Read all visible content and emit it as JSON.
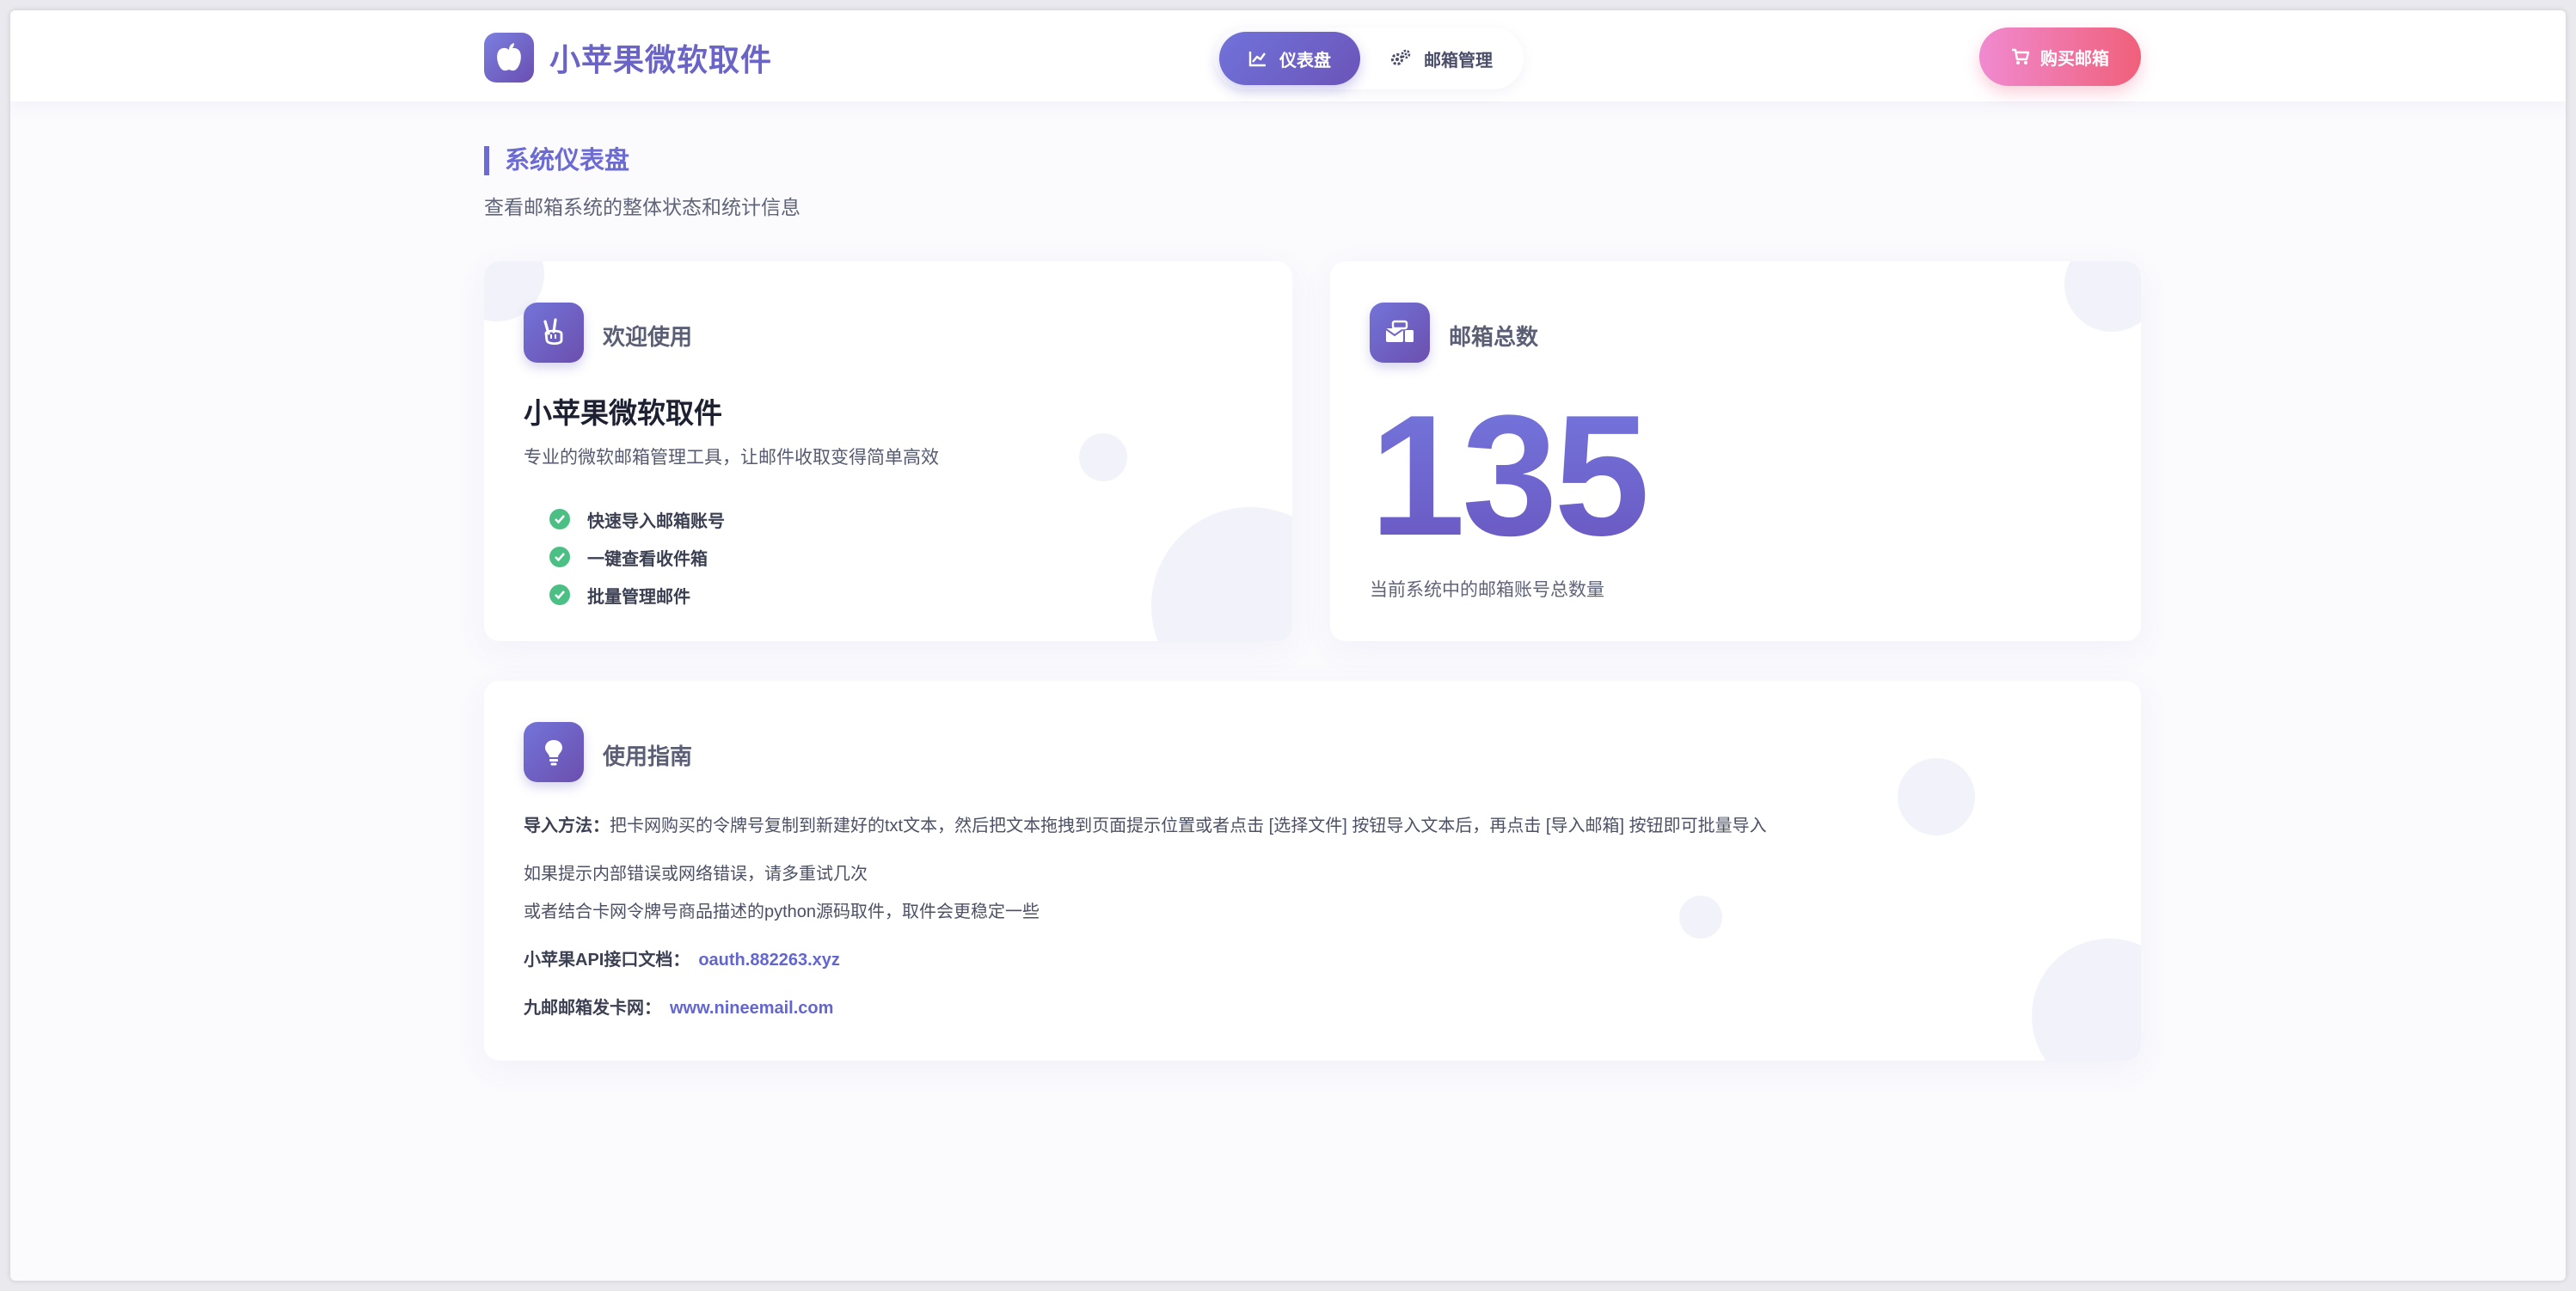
{
  "app": {
    "title": "小苹果微软取件",
    "logo_icon": "apple-icon"
  },
  "nav": {
    "tabs": [
      {
        "label": "仪表盘",
        "icon": "chart-line-icon",
        "active": true
      },
      {
        "label": "邮箱管理",
        "icon": "cogs-icon",
        "active": false
      }
    ],
    "buy_label": "购买邮箱",
    "buy_icon": "cart-icon"
  },
  "page": {
    "title": "系统仪表盘",
    "subtitle": "查看邮箱系统的整体状态和统计信息"
  },
  "welcome_card": {
    "heading": "欢迎使用",
    "icon": "hand-peace-icon",
    "title": "小苹果微软取件",
    "description": "专业的微软邮箱管理工具，让邮件收取变得简单高效",
    "features": [
      "快速导入邮箱账号",
      "一键查看收件箱",
      "批量管理邮件"
    ]
  },
  "total_card": {
    "heading": "邮箱总数",
    "icon": "mail-bulk-icon",
    "value": "135",
    "description": "当前系统中的邮箱账号总数量"
  },
  "guide_card": {
    "heading": "使用指南",
    "icon": "lightbulb-icon",
    "import_label": "导入方法：",
    "import_text": "把卡网购买的令牌号复制到新建好的txt文本，然后把文本拖拽到页面提示位置或者点击 [选择文件] 按钮导入文本后，再点击 [导入邮箱] 按钮即可批量导入",
    "tip1": "如果提示内部错误或网络错误，请多重试几次",
    "tip2": "或者结合卡网令牌号商品描述的python源码取件，取件会更稳定一些",
    "api_label": "小苹果API接口文档：",
    "api_link": "oauth.882263.xyz",
    "shop_label": "九邮邮箱发卡网：",
    "shop_link": "www.nineemail.com"
  },
  "colors": {
    "accent": "#6b6bd3",
    "gradient_start": "#7374d9",
    "gradient_end": "#6b4fae",
    "buy_start": "#f08ad0",
    "buy_end": "#f0607a",
    "success": "#4bbf84"
  }
}
